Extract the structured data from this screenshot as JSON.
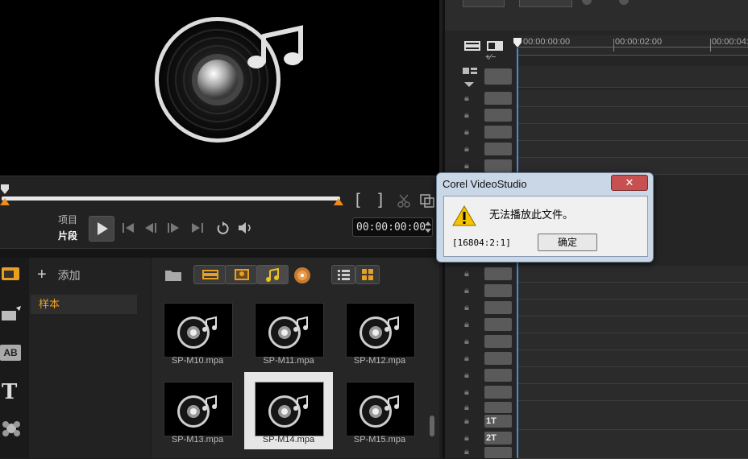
{
  "player": {
    "mode_project": "项目",
    "mode_clip": "片段",
    "mark_in": "[",
    "mark_out": "]",
    "timecode": "00:00:00:00"
  },
  "library": {
    "add_label": "添加",
    "folders": [
      {
        "label": "样本"
      }
    ],
    "thumbnails": [
      {
        "name": "SP-M10.mpa",
        "selected": false
      },
      {
        "name": "SP-M11.mpa",
        "selected": false
      },
      {
        "name": "SP-M12.mpa",
        "selected": false
      },
      {
        "name": "SP-M13.mpa",
        "selected": false
      },
      {
        "name": "SP-M14.mpa",
        "selected": true
      },
      {
        "name": "SP-M15.mpa",
        "selected": false
      }
    ]
  },
  "timeline": {
    "ruler": [
      "00:00:00:00",
      "00:00:02:00",
      "00:00:04:"
    ],
    "title_track_1": "1T",
    "title_track_2": "2T",
    "add_remove": "+∕−"
  },
  "dialog": {
    "title": "Corel VideoStudio",
    "close_label": "✕",
    "message": "无法播放此文件。",
    "error_code": "[16804:2:1]",
    "ok_label": "确定"
  },
  "colors": {
    "accent_orange": "#f0a020",
    "dialog_frame": "#c9d7e6",
    "close_red": "#c75050"
  },
  "icons": [
    "music-disc-icon",
    "play-icon",
    "warning-icon",
    "folder-icon",
    "film-icon",
    "photo-icon",
    "music-note-icon",
    "list-view-icon",
    "grid-view-icon",
    "lock-icon"
  ]
}
